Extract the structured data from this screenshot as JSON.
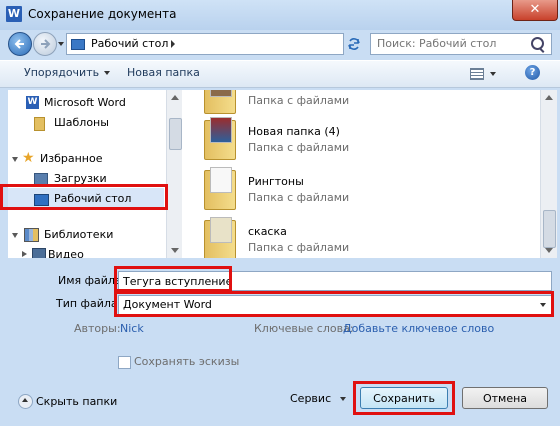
{
  "window": {
    "title": "Сохранение документа",
    "app_icon_letter": "W",
    "close_glyph": "✕"
  },
  "navbar": {
    "address_path": "Рабочий стол",
    "search_placeholder": "Поиск: Рабочий стол"
  },
  "toolbar": {
    "organize_label": "Упорядочить",
    "new_folder_label": "Новая папка",
    "help_glyph": "?"
  },
  "nav_tree": {
    "items": [
      {
        "label": "Microsoft Word",
        "icon": "word-icon"
      },
      {
        "label": "Шаблоны",
        "icon": "folder-icon"
      },
      {
        "label": "Избранное",
        "icon": "star-icon"
      },
      {
        "label": "Загрузки",
        "icon": "downloads-icon"
      },
      {
        "label": "Рабочий стол",
        "icon": "desktop-icon"
      },
      {
        "label": "Библиотеки",
        "icon": "libraries-icon"
      },
      {
        "label": "Видео",
        "icon": "video-icon"
      }
    ]
  },
  "files": {
    "items": [
      {
        "name": "",
        "type": "Папка с файлами"
      },
      {
        "name": "Новая папка (4)",
        "type": "Папка с файлами"
      },
      {
        "name": "Рингтоны",
        "type": "Папка с файлами"
      },
      {
        "name": "скаска",
        "type": "Папка с файлами"
      }
    ]
  },
  "form": {
    "filename_label": "Имя файла:",
    "filename_value": "Tегуга вступление",
    "filetype_label": "Тип файла:",
    "filetype_value": "Документ Word",
    "authors_label": "Авторы:",
    "authors_value": "Nick",
    "keywords_label": "Ключевые слова:",
    "keywords_value": "Добавьте ключевое слово",
    "thumbnails_label": "Сохранять эскизы"
  },
  "footer": {
    "hide_folders_label": "Скрыть папки",
    "service_label": "Сервис",
    "save_label": "Сохранить",
    "cancel_label": "Отмена"
  },
  "colors": {
    "highlight_red": "#e01010",
    "link_blue": "#2a5eae",
    "window_blue": "#c9ddf3"
  }
}
